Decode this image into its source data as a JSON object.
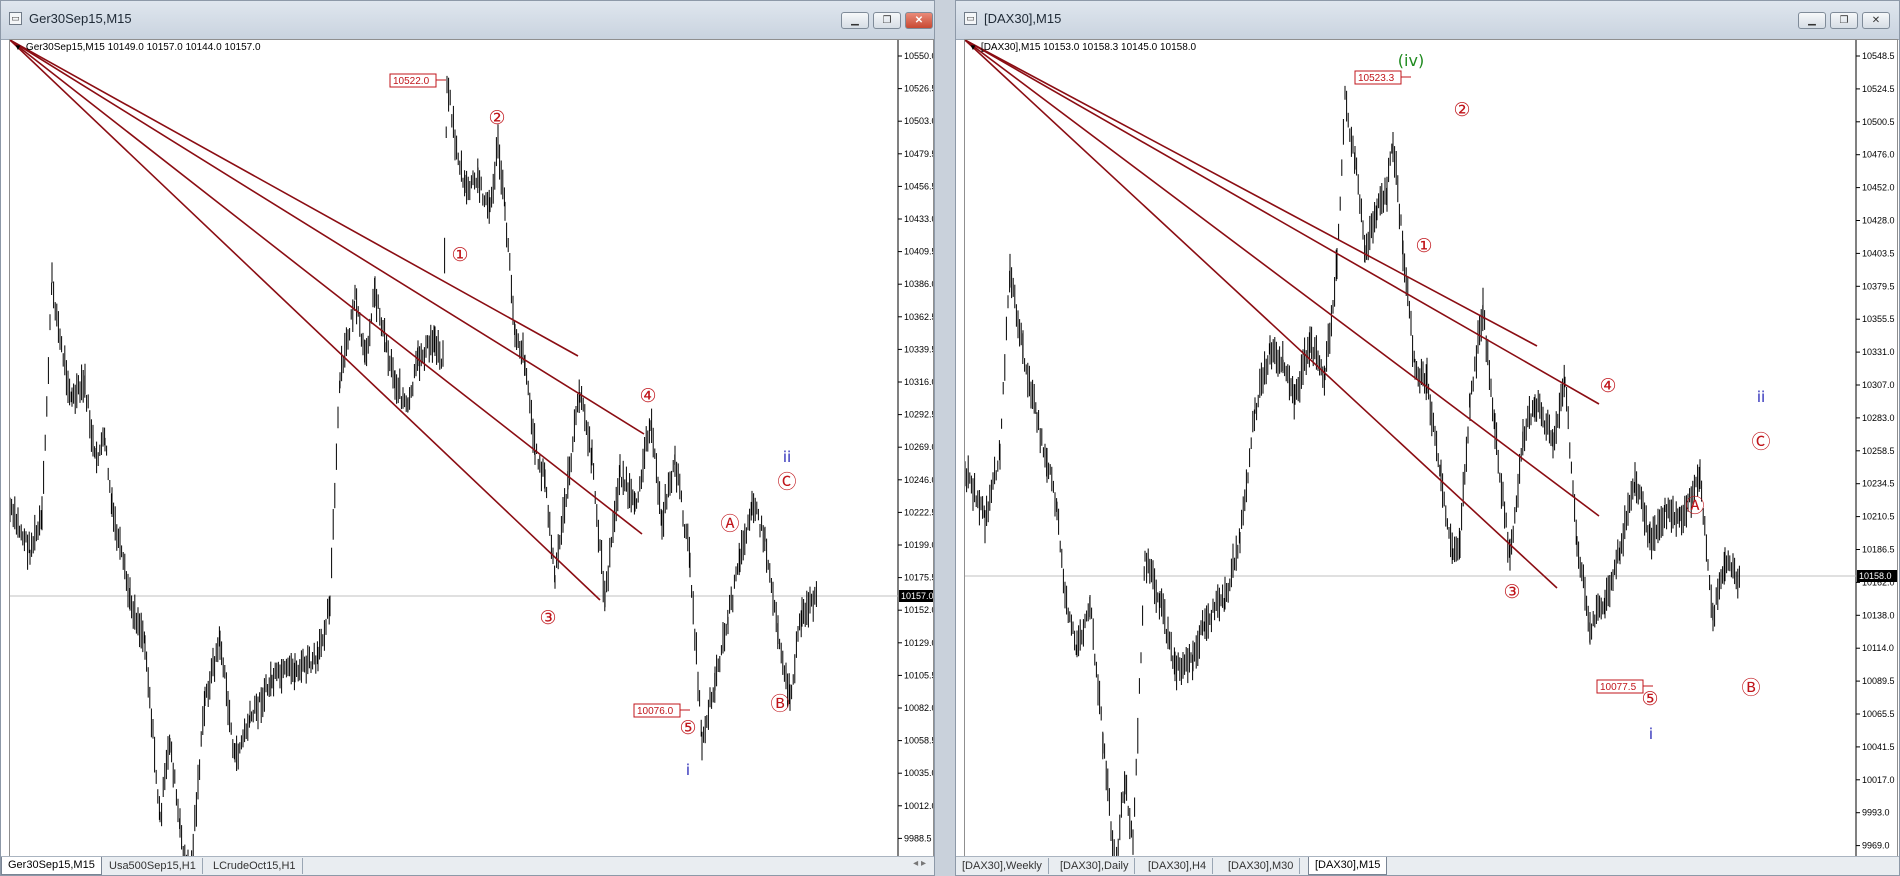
{
  "colors": {
    "candles": "#000000",
    "annotation_red": "#c0151b",
    "wave_blue": "#2a2ab8",
    "wave_green": "#1e8a1e",
    "trendline": "#8b0d13",
    "price_box_bg": "#000000",
    "bid_line": "#c0c0c0"
  },
  "windows": [
    {
      "title": "Ger30Sep15,M15",
      "symbol_line": "Ger30Sep15,M15  10149.0 10157.0 10144.0 10157.0",
      "price_axis": [
        "10550.0",
        "10526.5",
        "10503.0",
        "10479.5",
        "10456.5",
        "10433.0",
        "10409.5",
        "10386.0",
        "10362.5",
        "10339.5",
        "10316.0",
        "10292.5",
        "10269.0",
        "10246.0",
        "10222.5",
        "10199.0",
        "10175.5",
        "10152.0",
        "10129.0",
        "10105.5",
        "10082.0",
        "10058.5",
        "10035.0",
        "10012.0",
        "9988.5"
      ],
      "current_price": "10157.0",
      "box_labels": [
        "10522.0",
        "10076.0"
      ],
      "wave_labels": {
        "w1": "①",
        "w2": "②",
        "w3": "③",
        "w4": "④",
        "w5": "⑤",
        "wA": "Ⓐ",
        "wB": "Ⓑ",
        "wC": "Ⓒ",
        "i": "i",
        "ii": "ii"
      },
      "tabs": [
        {
          "label": "Ger30Sep15,M15",
          "active": true
        },
        {
          "label": "Usa500Sep15,H1",
          "active": false
        },
        {
          "label": "LCrudeOct15,H1",
          "active": false
        }
      ]
    },
    {
      "title": "[DAX30],M15",
      "symbol_line": "[DAX30],M15  10153.0 10158.3 10145.0 10158.0",
      "price_axis": [
        "10548.5",
        "10524.5",
        "10500.5",
        "10476.0",
        "10452.0",
        "10428.0",
        "10403.5",
        "10379.5",
        "10355.5",
        "10331.0",
        "10307.0",
        "10283.0",
        "10258.5",
        "10234.5",
        "10210.5",
        "10186.5",
        "10162.0",
        "10138.0",
        "10114.0",
        "10089.5",
        "10065.5",
        "10041.5",
        "10017.0",
        "9993.0",
        "9969.0"
      ],
      "current_price": "10158.0",
      "box_labels": [
        "10523.3",
        "10077.5"
      ],
      "wave_labels": {
        "w1": "①",
        "w2": "②",
        "w3": "③",
        "w4": "④",
        "w5": "⑤",
        "wA": "Ⓐ",
        "wB": "Ⓑ",
        "wC": "Ⓒ",
        "i": "i",
        "ii": "ii",
        "iv": "(iv)"
      },
      "tabs": [
        {
          "label": "[DAX30],Weekly",
          "active": false
        },
        {
          "label": "[DAX30],Daily",
          "active": false
        },
        {
          "label": "[DAX30],H4",
          "active": false
        },
        {
          "label": "[DAX30],M30",
          "active": false
        },
        {
          "label": "[DAX30],M15",
          "active": true
        }
      ]
    }
  ],
  "icons": {
    "chart": "chart-window-icon",
    "minimize": "minimize-icon",
    "restore": "restore-icon",
    "close": "close-icon"
  }
}
